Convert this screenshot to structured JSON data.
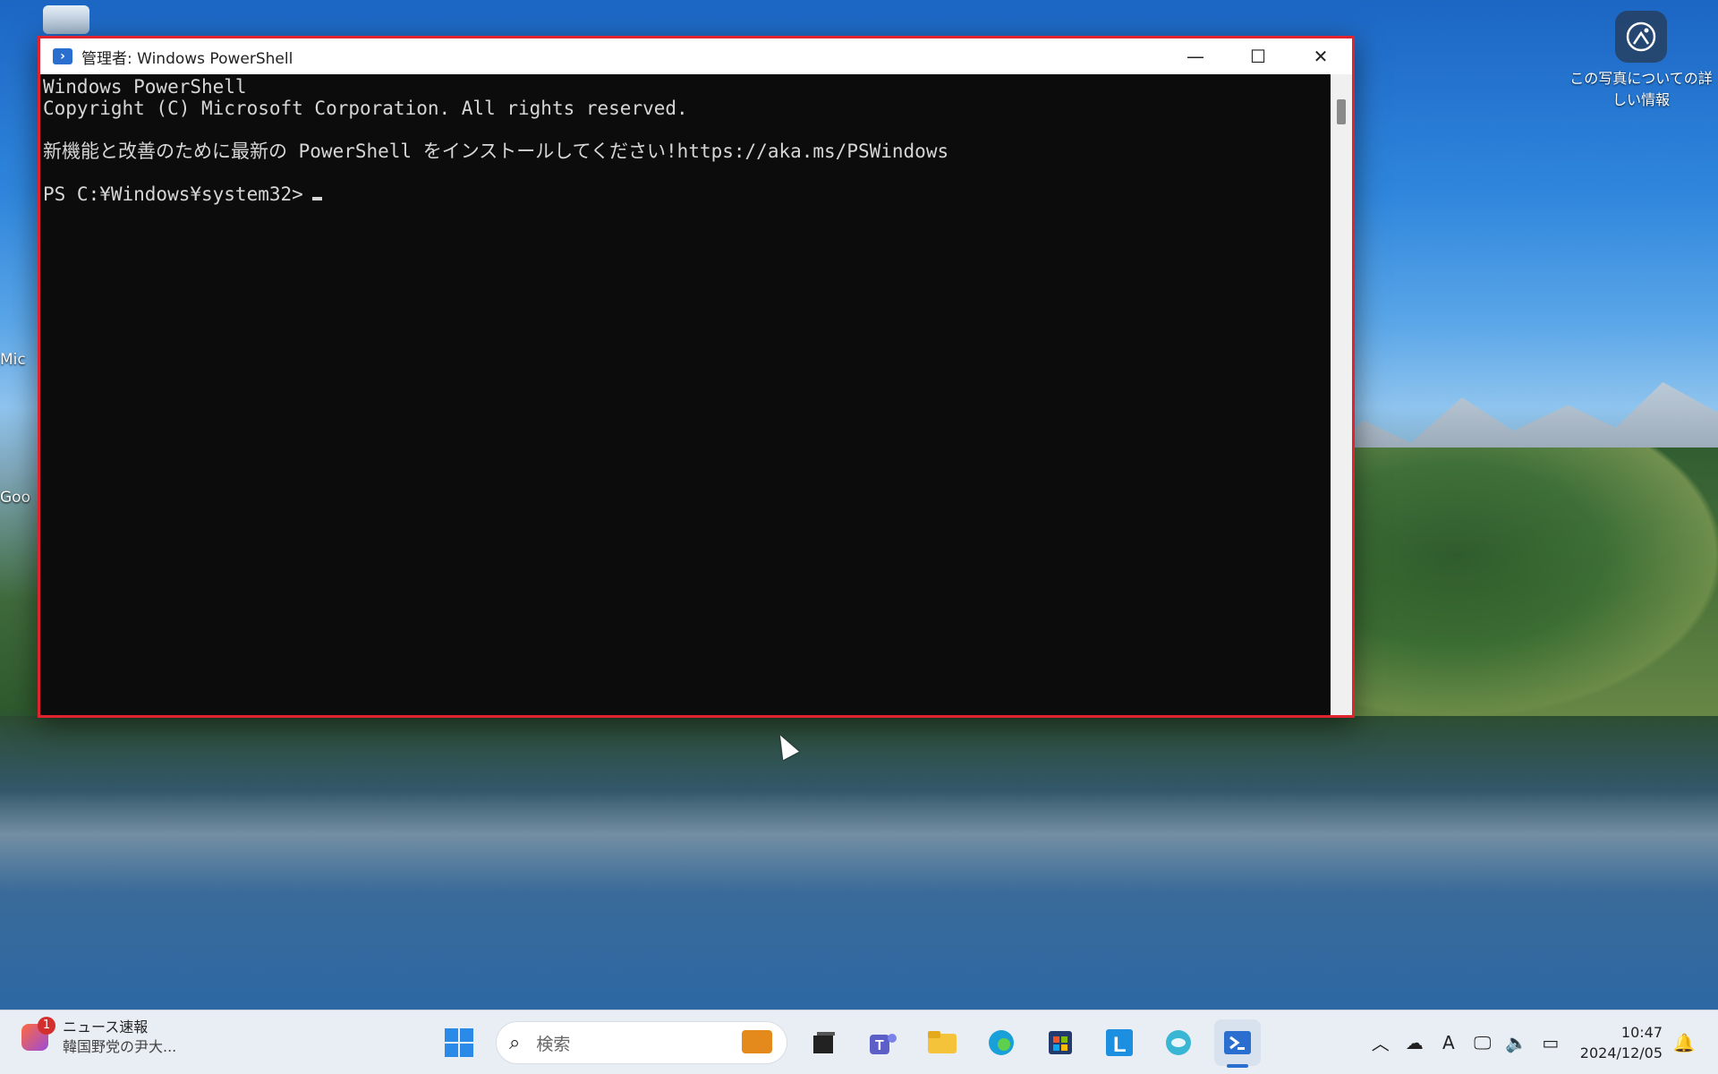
{
  "desktop": {
    "side_labels": [
      "Mic",
      "Goo"
    ],
    "photo_info": "この写真についての詳しい情報"
  },
  "window": {
    "title": "管理者: Windows PowerShell",
    "buttons": {
      "minimize": "—",
      "maximize": "☐",
      "close": "✕"
    },
    "console_lines": [
      "Windows PowerShell",
      "Copyright (C) Microsoft Corporation. All rights reserved.",
      "",
      "新機能と改善のために最新の PowerShell をインストールしてください!https://aka.ms/PSWindows",
      "",
      "PS C:¥Windows¥system32>"
    ]
  },
  "taskbar": {
    "news": {
      "badge_count": "1",
      "title": "ニュース速報",
      "subtitle": "韓国野党の尹大..."
    },
    "search_placeholder": "検索",
    "apps": [
      "start-icon",
      "task-view-icon",
      "teams-icon",
      "file-explorer-icon",
      "edge-icon",
      "store-icon",
      "l-app-icon",
      "app-icon",
      "powershell-icon"
    ],
    "tray": {
      "clock_time": "10:47",
      "clock_date": "2024/12/05"
    }
  }
}
